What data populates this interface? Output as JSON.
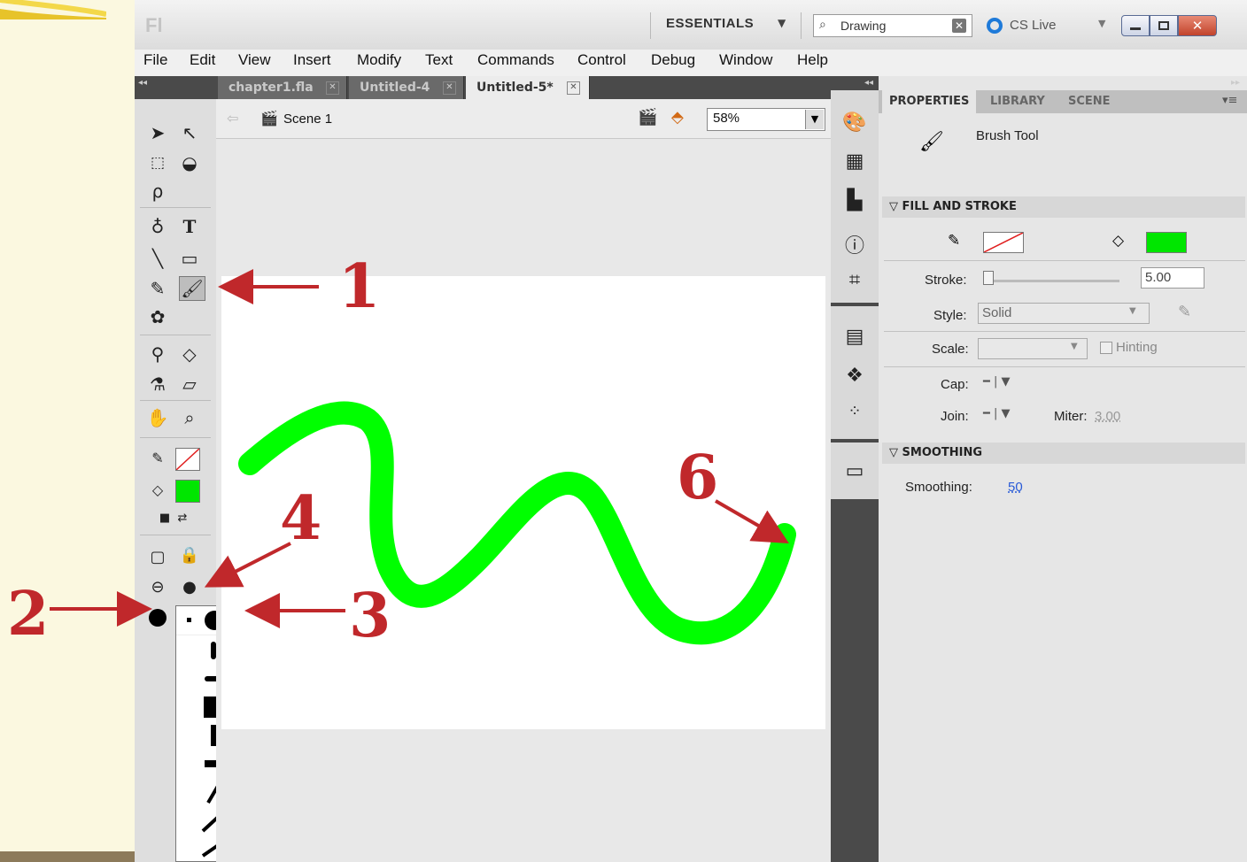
{
  "titlebar": {
    "workspace": "ESSENTIALS",
    "search_value": "Drawing",
    "cslive": "CS Live",
    "logo": "Fl"
  },
  "menu": [
    "File",
    "Edit",
    "View",
    "Insert",
    "Modify",
    "Text",
    "Commands",
    "Control",
    "Debug",
    "Window",
    "Help"
  ],
  "doc_tabs": [
    "chapter1.fla",
    "Untitled-4",
    "Untitled-5*"
  ],
  "edit_bar": {
    "scene": "Scene 1",
    "zoom": "58%"
  },
  "properties": {
    "tabs": [
      "PROPERTIES",
      "LIBRARY",
      "SCENE"
    ],
    "tool_name": "Brush Tool",
    "fill_stroke_title": "FILL AND STROKE",
    "stroke_label": "Stroke:",
    "stroke_value": "5.00",
    "style_label": "Style:",
    "style_value": "Solid",
    "scale_label": "Scale:",
    "hinting_label": "Hinting",
    "cap_label": "Cap:",
    "join_label": "Join:",
    "miter_label": "Miter:",
    "miter_value": "3.00",
    "smoothing_title": "SMOOTHING",
    "smoothing_label": "Smoothing:",
    "smoothing_value": "50"
  },
  "colors": {
    "fill": "#00e600",
    "stroke_line": "#00ff00",
    "annotation": "#c0282b"
  },
  "annotations": [
    "1",
    "2",
    "3",
    "4",
    "6"
  ]
}
